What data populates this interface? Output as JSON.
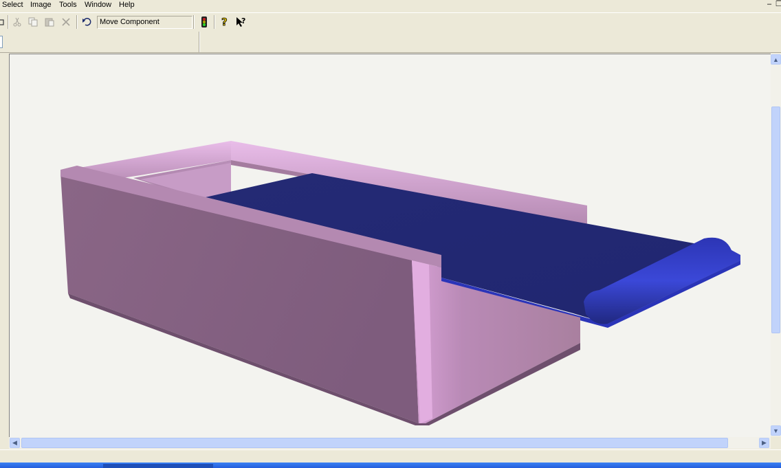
{
  "menu": {
    "items": [
      "Select",
      "Image",
      "Tools",
      "Window",
      "Help"
    ]
  },
  "window_controls": {
    "minimize": "–",
    "restore": "❐"
  },
  "toolbar": {
    "command_text": "Move Component",
    "buttons": {
      "cut": "cut-icon",
      "copy": "copy-icon",
      "paste": "paste-icon",
      "delete": "delete-icon",
      "undo": "undo-icon",
      "traffic_light": "traffic-light-icon",
      "help": "help-icon",
      "context_help": "context-help-icon"
    }
  },
  "colors": {
    "box_body": "#a07a9c",
    "box_highlight": "#e6b8e6",
    "lid": "#232a78",
    "lid_highlight": "#3a46d8",
    "viewport_bg": "#f3f3ef",
    "scroll_accent": "#c1d3fb"
  },
  "scrollbars": {
    "vertical_position": 0.4,
    "horizontal_position": 0.0
  }
}
